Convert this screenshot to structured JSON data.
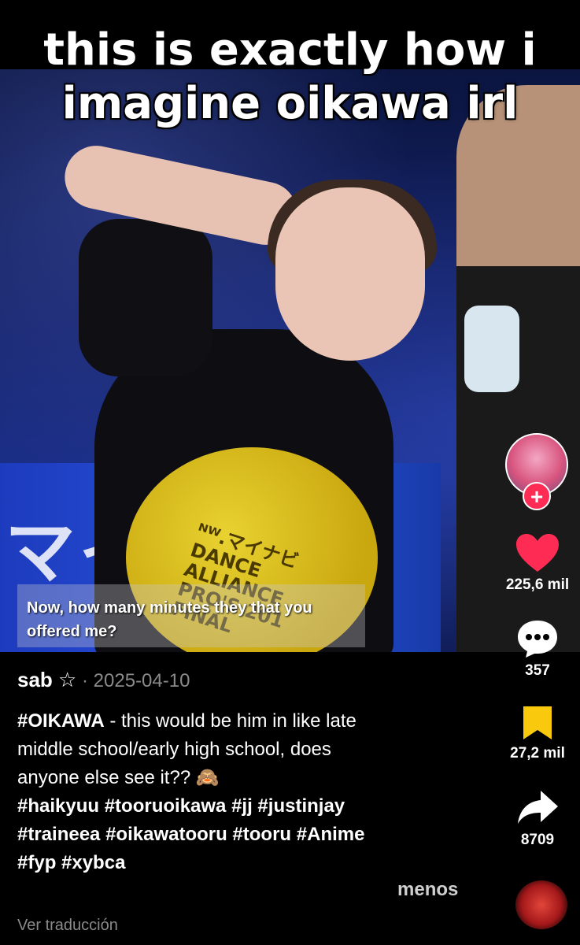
{
  "overlay_title": {
    "line1": "this is exactly how i",
    "line2": "imagine oikawa irl"
  },
  "video": {
    "subtitle": "Now, how many minutes they that you offered me?",
    "sign_text": "マイ",
    "plate_text": "ᴺᵂ.マイナビ DANCE ALLIANCE PRO'S 201 FINAL"
  },
  "actions": {
    "like": {
      "icon": "heart-icon",
      "count": "225,6 mil",
      "color": "#fe2c55"
    },
    "comment": {
      "icon": "comment-icon",
      "count": "357"
    },
    "save": {
      "icon": "bookmark-icon",
      "count": "27,2 mil",
      "color": "#f8c90c"
    },
    "share": {
      "icon": "share-icon",
      "count": "8709"
    },
    "follow": {
      "label": "+"
    }
  },
  "post": {
    "author": "sab ☆",
    "separator": " · ",
    "date": "2025-04-10",
    "description_lead": "#OIKAWA",
    "description_body": " - this would be him in like late\nmiddle school/early high school, does\nanyone else see it?? 🙈\n",
    "hashtags": " #haikyuu #tooruoikawa #jj #justinjay\n#traineea #oikawatooru #tooru #Anime\n#fyp #xybca",
    "collapse_label": "menos",
    "translate_label": "Ver traducción"
  }
}
